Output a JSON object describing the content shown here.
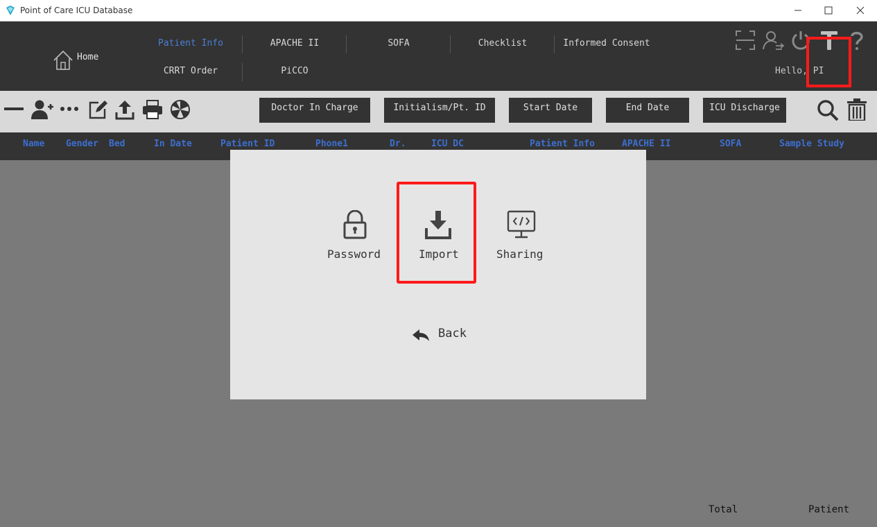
{
  "window": {
    "title": "Point of Care ICU Database"
  },
  "nav": {
    "home": "Home",
    "row1": [
      "Patient Info",
      "APACHE II",
      "SOFA",
      "Checklist",
      "Informed Consent"
    ],
    "row2": [
      "CRRT Order",
      "PiCCO"
    ],
    "greeting": "Hello, PI",
    "active": "Patient Info"
  },
  "filters": {
    "doctor": "Doctor In Charge",
    "initialism": "Initialism/Pt. ID",
    "start": "Start Date",
    "end": "End Date",
    "discharge": "ICU Discharge"
  },
  "columns": [
    "Name",
    "Gender",
    "Bed",
    "In Date",
    "Patient ID",
    "Phone1",
    "Dr.",
    "ICU DC",
    "Patient Info",
    "APACHE II",
    "SOFA",
    "Sample Study"
  ],
  "modal": {
    "password": "Password",
    "import": "Import",
    "sharing": "Sharing",
    "back": "Back"
  },
  "footer": {
    "total": "Total",
    "patient": "Patient"
  },
  "colors": {
    "accent": "#4a7fd4",
    "highlight": "#ff1a1a",
    "header_text": "#3d6fd0",
    "dark_bar": "#333333"
  }
}
